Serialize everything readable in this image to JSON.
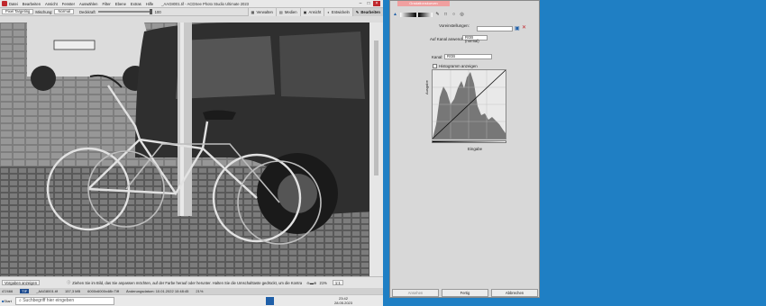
{
  "app": {
    "menu": [
      "Datei",
      "Bearbeiten",
      "Ansicht",
      "Fenster",
      "Auswählen",
      "Filter",
      "Ebene",
      "Extras",
      "Hilfe"
    ],
    "title": "_AAG8001.tif - ACDSee Photo Studio Ultimate 2023",
    "modes": [
      {
        "label": "Verwalten",
        "icon": "manage-icon"
      },
      {
        "label": "Medien",
        "icon": "media-icon"
      },
      {
        "label": "Ansicht",
        "icon": "view-icon"
      },
      {
        "label": "Entwickeln",
        "icon": "develop-icon"
      },
      {
        "label": "Bearbeiten",
        "icon": "edit-icon"
      }
    ],
    "active_mode": "Bearbeiten"
  },
  "toolbar": {
    "targeting": "Pixel Targeting",
    "blend_label": "Mischung:",
    "blend_value": "Normal",
    "opacity_label": "Deckkraft",
    "opacity_value": "100"
  },
  "bottom": {
    "show_previous": "Vorgaben anzeigen",
    "hint": "Ziehen Sie im Bild, das Sie anpassen möchten, auf der Farbe herauf oder herunter. Halten Sie die Umschalttaste gedrückt, um die Kontrast...",
    "zoom": "21%",
    "zoom2": "1:1"
  },
  "status": {
    "index": "47/466",
    "format": "TIF",
    "filename": "_AAG8001.tif",
    "size": "157,3 MB",
    "dimensions": "6000x6000x48b Tiff",
    "modified": "Änderungsdatum: 10.01.2022 10:48:45",
    "zoom": "21%"
  },
  "taskbar": {
    "start": "Start",
    "search_placeholder": "Suchbegriff hier eingeben",
    "time": "23:42",
    "date": "28.05.2023"
  },
  "dialog": {
    "title": "Gradationskurven",
    "preset_label": "Voreinstellungen:",
    "preset_value": "",
    "apply_label": "Auf Kanal anwenden:",
    "apply_value": "RGB (normal)",
    "channel_label": "Kanal:",
    "channel_value": "RGB",
    "histogram_label": "Histogramm anzeigen",
    "x_axis": "Eingabe",
    "y_axis": "Ausgabe",
    "buttons": {
      "reset": "Ansehen",
      "done": "Fertig",
      "cancel": "Abbrechen"
    }
  },
  "colors": {
    "accent_red": "#c0282d",
    "dialog_title": "#f0a0a0",
    "desktop_blue": "#1f7fc4"
  }
}
